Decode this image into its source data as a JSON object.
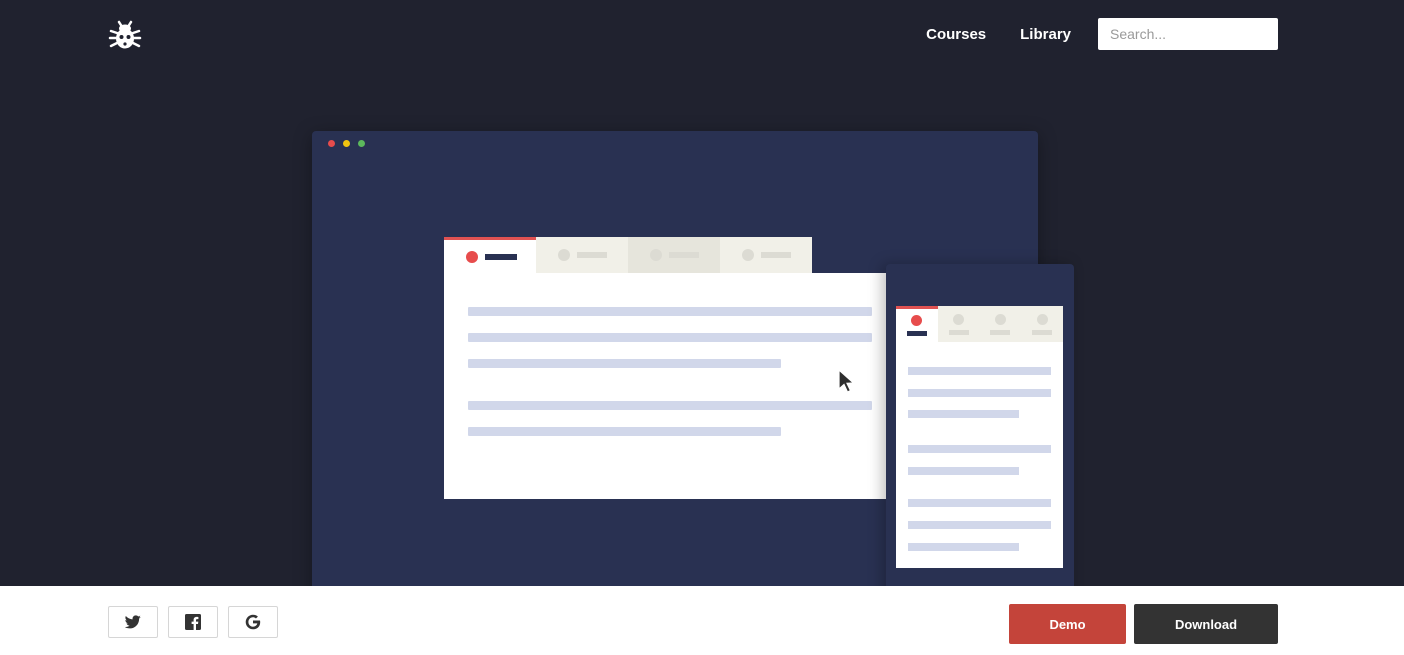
{
  "header": {
    "logo_icon": "bug-icon",
    "nav": [
      {
        "label": "Courses"
      },
      {
        "label": "Library"
      }
    ],
    "search": {
      "placeholder": "Search...",
      "value": ""
    }
  },
  "illustration": {
    "window_dot_colors": [
      "#e74c4c",
      "#f1c40f",
      "#5cb85c"
    ],
    "accent": "#e74c4c",
    "cursor_icon": "mouse-pointer-icon"
  },
  "footer": {
    "social": [
      {
        "icon": "twitter-icon"
      },
      {
        "icon": "facebook-icon"
      },
      {
        "icon": "google-icon"
      }
    ],
    "demo_label": "Demo",
    "download_label": "Download",
    "demo_color": "#c4443a",
    "download_color": "#333333"
  }
}
